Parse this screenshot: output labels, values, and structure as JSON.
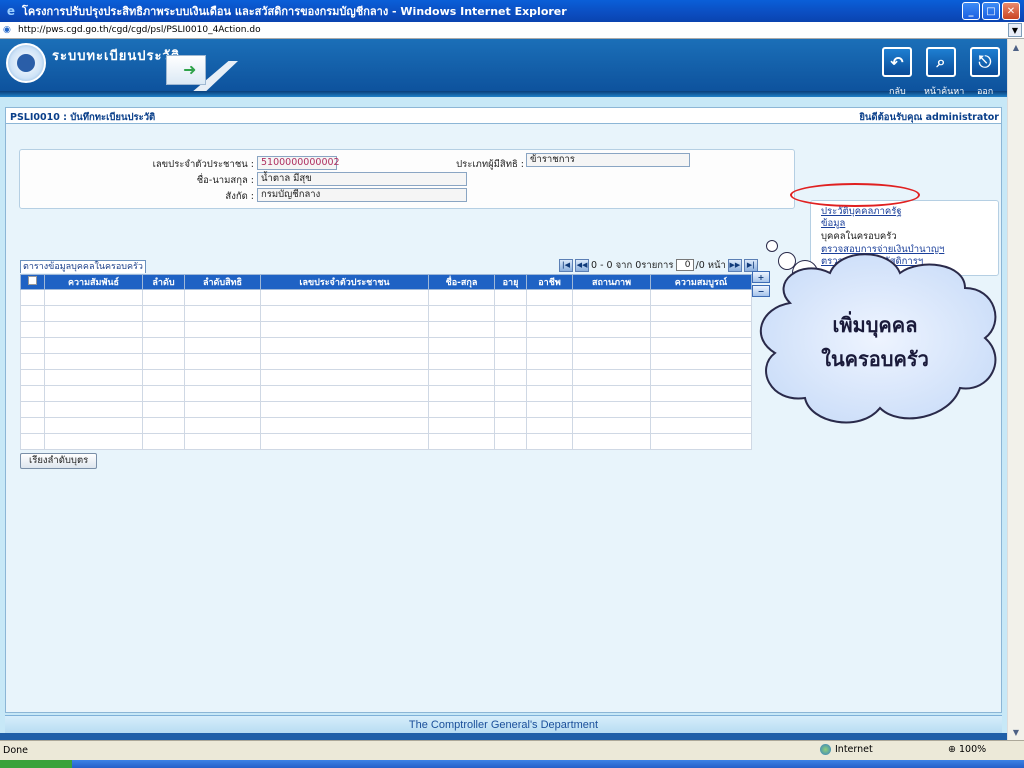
{
  "window": {
    "title": "โครงการปรับปรุงประสิทธิภาพระบบเงินเดือน และสวัสดิการของกรมบัญชีกลาง - Windows Internet Explorer",
    "url": "http://pws.cgd.go.th/cgd/cgd/psl/PSLI0010_4Action.do"
  },
  "header": {
    "system_title": "ระบบทะเบียนประวัติ",
    "back_label": "กลับ",
    "home_label": "หน้าค้นหา",
    "exit_label": "ออก"
  },
  "page": {
    "id_title": "PSLI0010 : บันทึกทะเบียนประวัติ",
    "welcome": "ยินดีต้อนรับคุณ administrator"
  },
  "form": {
    "citizen_id_label": "เลขประจำตัวประชาชน :",
    "citizen_id_value": "5100000000002",
    "name_label": "ชื่อ-นามสกุล :",
    "name_value": "น้ำตาล มีสุข",
    "dept_label": "สังกัด :",
    "dept_value": "กรมบัญชีกลาง",
    "type_label": "ประเภทผู้มีสิทธิ :",
    "type_value": "ข้าราชการ"
  },
  "links": [
    "ประวัติบุคคลภาครัฐ",
    "ข้อมูล",
    "บุคคลในครอบครัว",
    "ตรวจสอบการจ่ายเงินบำนาญฯ",
    "ตรวจสอบสิทธิสวัสดิการฯ"
  ],
  "grid": {
    "caption": "ตารางข้อมูลบุคคลในครอบครัว",
    "pager_text": "0 - 0 จาก 0รายการ",
    "page_value": "0",
    "page_suffix": "/0 หน้า",
    "columns": [
      "ความสัมพันธ์",
      "ลำดับ",
      "ลำดับสิทธิ",
      "เลขประจำตัวประชาชน",
      "ชื่อ-สกุล",
      "อายุ",
      "อาชีพ",
      "สถานภาพ",
      "ความสมบูรณ์"
    ],
    "empty_rows": 10
  },
  "sort_button": "เรียงลำดับบุตร",
  "footer": "The Comptroller General's Department",
  "status": {
    "done": "Done",
    "zone": "Internet",
    "zoom": "100%"
  },
  "annotation": {
    "line1": "เพิ่มบุคคล",
    "line2": "ในครอบครัว"
  }
}
